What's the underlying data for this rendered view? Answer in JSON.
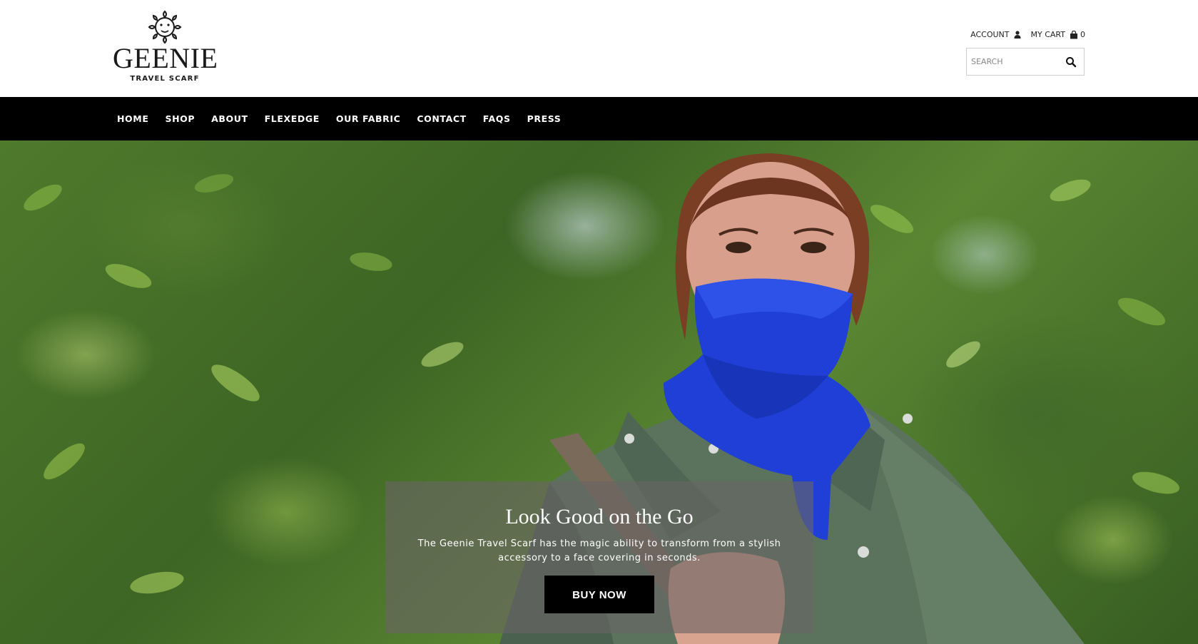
{
  "brand": {
    "name": "GEENIE",
    "tagline": "TRAVEL SCARF"
  },
  "utility": {
    "account_label": "ACCOUNT",
    "account_icon": "user-icon",
    "cart_label": "MY CART",
    "cart_icon": "shopping-bag-icon",
    "cart_count": "0"
  },
  "search": {
    "placeholder": "SEARCH",
    "value": "",
    "icon": "search-icon"
  },
  "nav": {
    "items": [
      {
        "label": "HOME"
      },
      {
        "label": "SHOP"
      },
      {
        "label": "ABOUT"
      },
      {
        "label": "FLEXEDGE"
      },
      {
        "label": "OUR FABRIC"
      },
      {
        "label": "CONTACT"
      },
      {
        "label": "FAQS"
      },
      {
        "label": "PRESS"
      }
    ]
  },
  "hero": {
    "title": "Look Good on the Go",
    "text": "The Geenie Travel Scarf has the magic ability to transform from a stylish accessory to a face covering in seconds.",
    "button_label": "BUY NOW"
  },
  "colors": {
    "nav_background": "#000000",
    "scarf_blue": "#1f3fd6",
    "jacket_green": "#5b735d",
    "button_background": "#000000"
  }
}
